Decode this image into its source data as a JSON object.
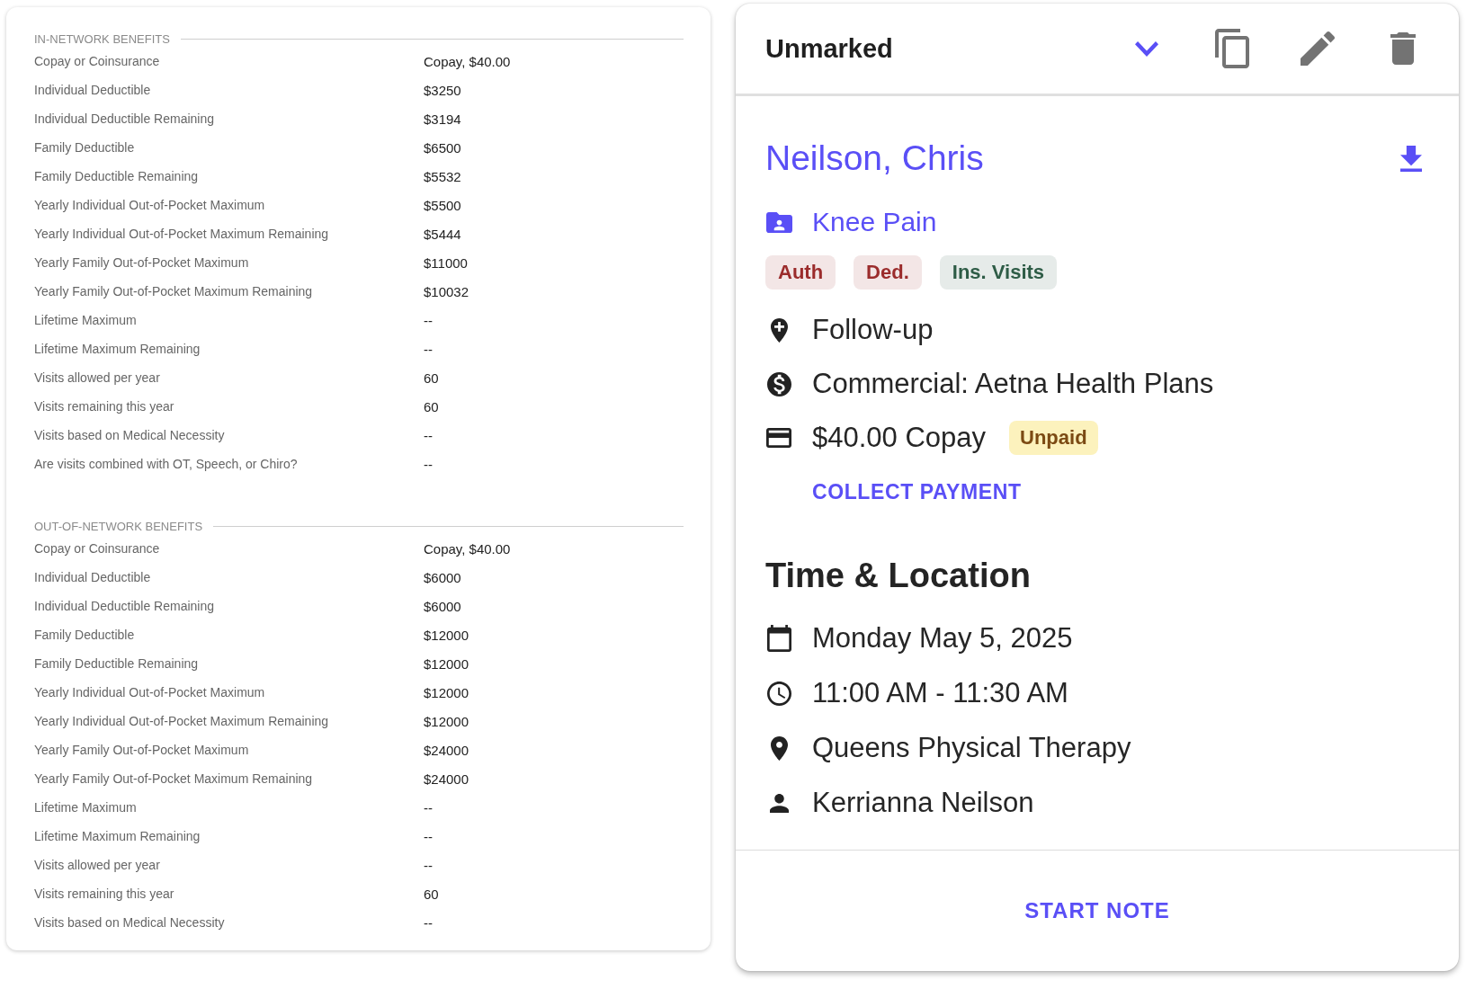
{
  "benefits": [
    {
      "title": "IN-NETWORK BENEFITS",
      "rows": [
        {
          "label": "Copay or Coinsurance",
          "value": "Copay, $40.00"
        },
        {
          "label": "Individual Deductible",
          "value": "$3250"
        },
        {
          "label": "Individual Deductible Remaining",
          "value": "$3194"
        },
        {
          "label": "Family Deductible",
          "value": "$6500"
        },
        {
          "label": "Family Deductible Remaining",
          "value": "$5532"
        },
        {
          "label": "Yearly Individual Out-of-Pocket Maximum",
          "value": "$5500"
        },
        {
          "label": "Yearly Individual Out-of-Pocket Maximum Remaining",
          "value": "$5444"
        },
        {
          "label": "Yearly Family Out-of-Pocket Maximum",
          "value": "$11000"
        },
        {
          "label": "Yearly Family Out-of-Pocket Maximum Remaining",
          "value": "$10032"
        },
        {
          "label": "Lifetime Maximum",
          "value": "--"
        },
        {
          "label": "Lifetime Maximum Remaining",
          "value": "--"
        },
        {
          "label": "Visits allowed per year",
          "value": "60"
        },
        {
          "label": "Visits remaining this year",
          "value": "60"
        },
        {
          "label": "Visits based on Medical Necessity",
          "value": "--"
        },
        {
          "label": "Are visits combined with OT, Speech, or Chiro?",
          "value": "--"
        }
      ]
    },
    {
      "title": "OUT-OF-NETWORK BENEFITS",
      "rows": [
        {
          "label": "Copay or Coinsurance",
          "value": "Copay, $40.00"
        },
        {
          "label": "Individual Deductible",
          "value": "$6000"
        },
        {
          "label": "Individual Deductible Remaining",
          "value": "$6000"
        },
        {
          "label": "Family Deductible",
          "value": "$12000"
        },
        {
          "label": "Family Deductible Remaining",
          "value": "$12000"
        },
        {
          "label": "Yearly Individual Out-of-Pocket Maximum",
          "value": "$12000"
        },
        {
          "label": "Yearly Individual Out-of-Pocket Maximum Remaining",
          "value": "$12000"
        },
        {
          "label": "Yearly Family Out-of-Pocket Maximum",
          "value": "$24000"
        },
        {
          "label": "Yearly Family Out-of-Pocket Maximum Remaining",
          "value": "$24000"
        },
        {
          "label": "Lifetime Maximum",
          "value": "--"
        },
        {
          "label": "Lifetime Maximum Remaining",
          "value": "--"
        },
        {
          "label": "Visits allowed per year",
          "value": "--"
        },
        {
          "label": "Visits remaining this year",
          "value": "60"
        },
        {
          "label": "Visits based on Medical Necessity",
          "value": "--"
        }
      ]
    }
  ],
  "appointment": {
    "status": "Unmarked",
    "patient_name": "Neilson, Chris",
    "case": "Knee Pain",
    "tags": [
      {
        "label": "Auth",
        "color": "#9b2c2c"
      },
      {
        "label": "Ded.",
        "color": "#9b2c2c"
      },
      {
        "label": "Ins. Visits",
        "color": "#2e5c46"
      }
    ],
    "visit_type": "Follow-up",
    "insurance": "Commercial: Aetna Health Plans",
    "copay": {
      "amount": "$40.00 Copay",
      "status": "Unpaid",
      "action": "COLLECT PAYMENT"
    },
    "time_location": {
      "title": "Time & Location",
      "date": "Monday May 5, 2025",
      "time": "11:00 AM - 11:30 AM",
      "location": "Queens Physical Therapy",
      "provider": "Kerrianna Neilson"
    },
    "footer_action": "START NOTE"
  }
}
